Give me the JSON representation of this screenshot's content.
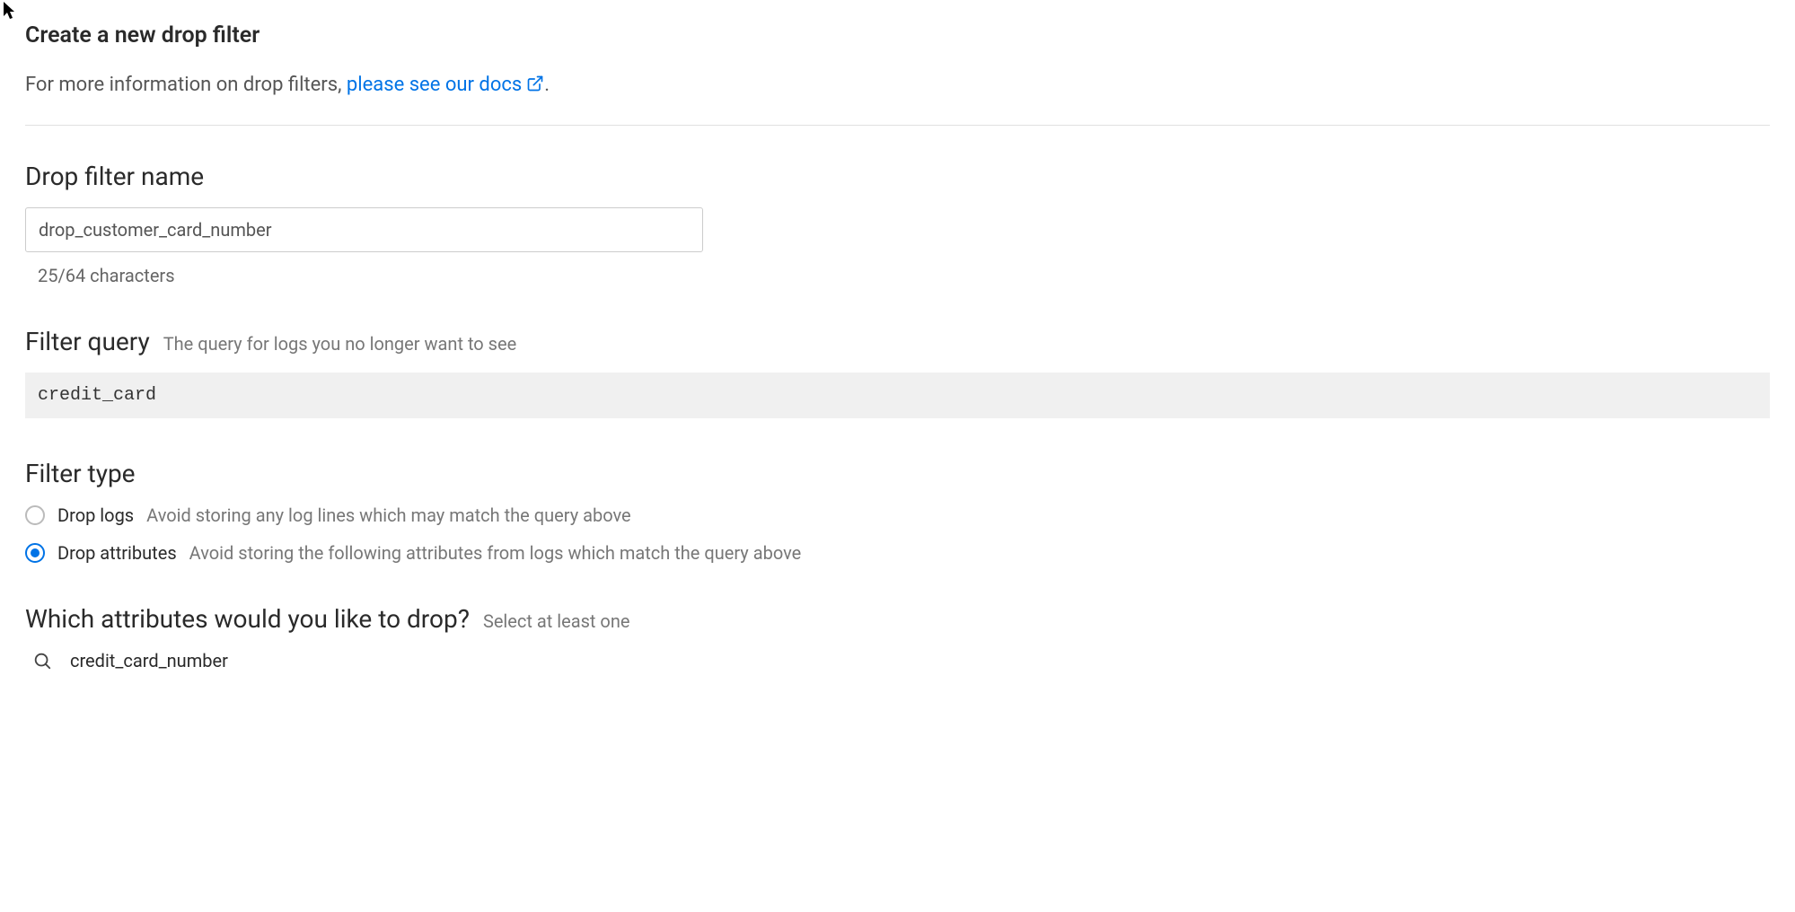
{
  "title": "Create a new drop filter",
  "info": {
    "prefix": "For more information on drop filters, ",
    "link_text": "please see our docs",
    "suffix": "."
  },
  "name_section": {
    "label": "Drop filter name",
    "value": "drop_customer_card_number",
    "char_count": "25/64 characters"
  },
  "query_section": {
    "label": "Filter query",
    "hint": "The query for logs you no longer want to see",
    "value": "credit_card"
  },
  "type_section": {
    "label": "Filter type",
    "options": [
      {
        "label": "Drop logs",
        "desc": "Avoid storing any log lines which may match the query above",
        "selected": false
      },
      {
        "label": "Drop attributes",
        "desc": "Avoid storing the following attributes from logs which match the query above",
        "selected": true
      }
    ]
  },
  "attr_section": {
    "label": "Which attributes would you like to drop?",
    "hint": "Select at least one",
    "value": "credit_card_number"
  }
}
